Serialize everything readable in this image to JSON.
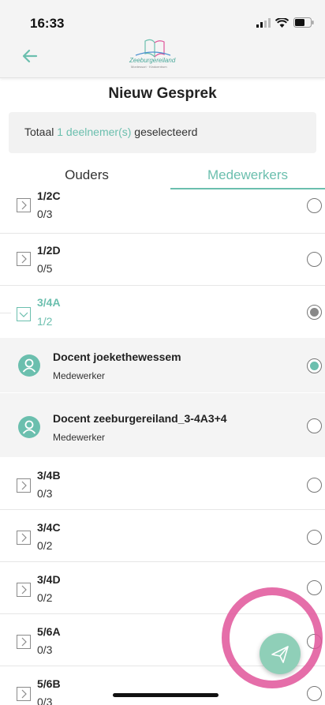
{
  "status_bar": {
    "time": "16:33"
  },
  "header": {
    "back_icon": "arrow-left-icon",
    "logo_text": "Zeeburgereiland",
    "logo_subtext": "Montessori · Kindcentrum"
  },
  "page": {
    "title": "Nieuw Gesprek",
    "summary_prefix": "Totaal",
    "summary_highlight": "1 deelnemer(s)",
    "summary_suffix": "geselecteerd"
  },
  "tabs": [
    {
      "label": "Ouders",
      "active": false
    },
    {
      "label": "Medewerkers",
      "active": true
    }
  ],
  "list": [
    {
      "name": "1/2C",
      "count": "0/3",
      "expanded": false,
      "selected": "none"
    },
    {
      "name": "1/2D",
      "count": "0/5",
      "expanded": false,
      "selected": "none"
    },
    {
      "name": "3/4A",
      "count": "1/2",
      "expanded": true,
      "selected": "partial"
    },
    {
      "person": "Docent joekethewessem",
      "role": "Medewerker",
      "selected": "full"
    },
    {
      "person": "Docent zeeburgereiland_3-4A3+4",
      "role": "Medewerker",
      "selected": "none"
    },
    {
      "name": "3/4B",
      "count": "0/3",
      "expanded": false,
      "selected": "none"
    },
    {
      "name": "3/4C",
      "count": "0/2",
      "expanded": false,
      "selected": "none"
    },
    {
      "name": "3/4D",
      "count": "0/2",
      "expanded": false,
      "selected": "none"
    },
    {
      "name": "5/6A",
      "count": "0/3",
      "expanded": false,
      "selected": "none"
    },
    {
      "name": "5/6B",
      "count": "0/3",
      "expanded": false,
      "selected": "none"
    }
  ],
  "fab": {
    "icon": "send-icon"
  },
  "colors": {
    "accent": "#6bbfae",
    "partial": "#888888",
    "annotation": "#e0559a",
    "fab": "#8fcfb8"
  }
}
